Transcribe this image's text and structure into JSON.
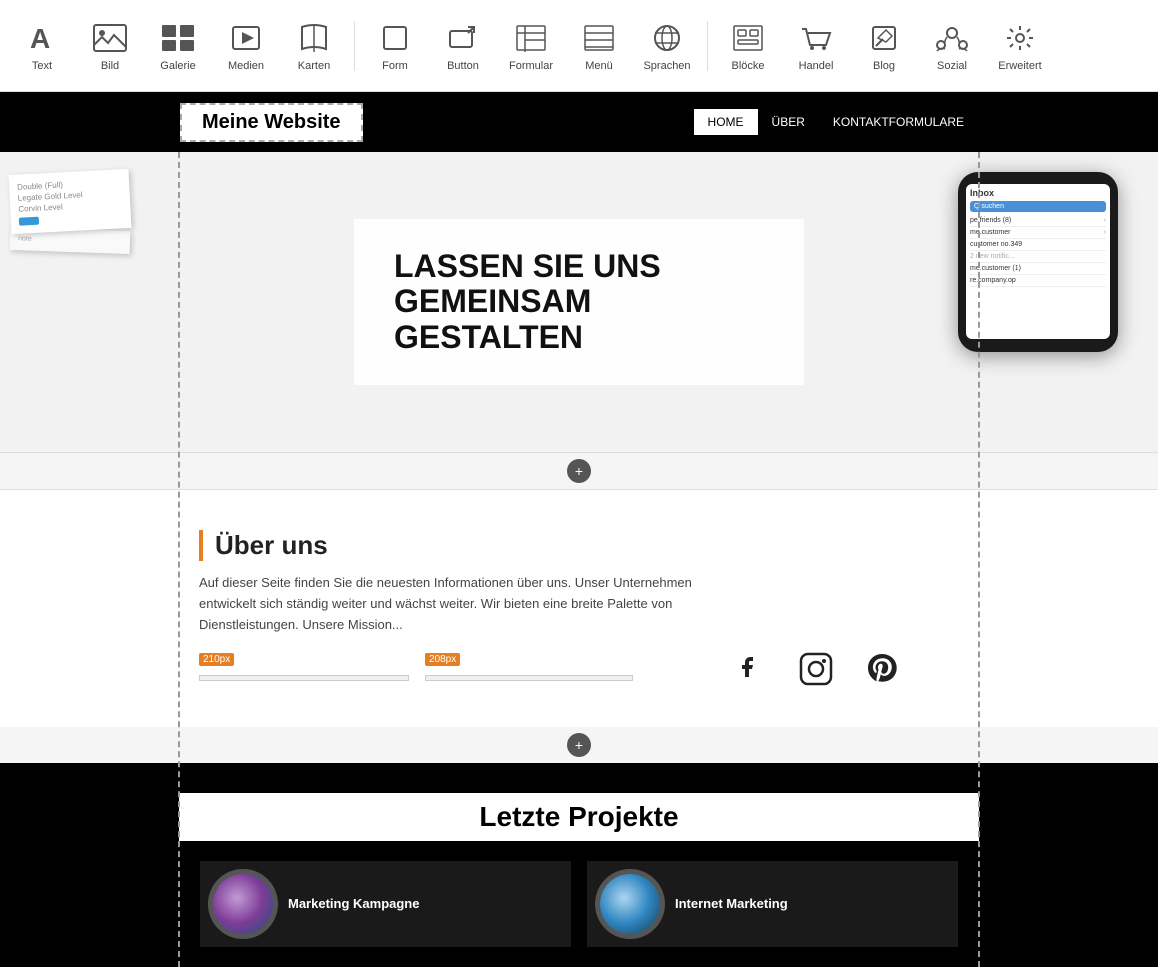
{
  "toolbar": {
    "items": [
      {
        "id": "text",
        "label": "Text",
        "icon": "A"
      },
      {
        "id": "bild",
        "label": "Bild",
        "icon": "🖼"
      },
      {
        "id": "galerie",
        "label": "Galerie",
        "icon": "⊞"
      },
      {
        "id": "medien",
        "label": "Medien",
        "icon": "▶"
      },
      {
        "id": "karten",
        "label": "Karten",
        "icon": "📖"
      },
      {
        "id": "form",
        "label": "Form",
        "icon": "□"
      },
      {
        "id": "button",
        "label": "Button",
        "icon": "↗"
      },
      {
        "id": "formular",
        "label": "Formular",
        "icon": "▦"
      },
      {
        "id": "menue",
        "label": "Menü",
        "icon": "⊟"
      },
      {
        "id": "sprachen",
        "label": "Sprachen",
        "icon": "🌐"
      },
      {
        "id": "bloecke",
        "label": "Blöcke",
        "icon": "⊡"
      },
      {
        "id": "handel",
        "label": "Handel",
        "icon": "🛒"
      },
      {
        "id": "blog",
        "label": "Blog",
        "icon": "✏"
      },
      {
        "id": "sozial",
        "label": "Sozial",
        "icon": "👥"
      },
      {
        "id": "erweitert",
        "label": "Erweitert",
        "icon": "⚙"
      }
    ]
  },
  "site": {
    "logo": "Meine Website",
    "nav": [
      {
        "label": "HOME",
        "active": true
      },
      {
        "label": "ÜBER",
        "active": false
      },
      {
        "label": "KONTAKTFORMULARE",
        "active": false
      }
    ]
  },
  "hero": {
    "title": "LASSEN SIE UNS GEMEINSAM GESTALTEN",
    "phone_inbox": "Inbox",
    "phone_search": "Q suchen",
    "phone_rows": [
      "pe.friends (8)",
      "me.customer",
      "customer no.349",
      "2 new notific...",
      "me.customer (1)",
      "re.company.op"
    ]
  },
  "about": {
    "heading": "Über uns",
    "text": "Auf dieser Seite finden Sie die neuesten Informationen über uns. Unser Unternehmen entwickelt sich ständig weiter und wächst weiter. Wir bieten eine breite Palette von Dienstleistungen. Unsere Mission...",
    "placeholder_210": "210px",
    "placeholder_208": "208px",
    "social_icons": [
      "f",
      "instagram",
      "p"
    ]
  },
  "projects": {
    "title": "Letzte Projekte",
    "cards": [
      {
        "name": "Marketing Kampagne"
      },
      {
        "name": "Internet Marketing"
      }
    ]
  },
  "colors": {
    "accent_orange": "#e67e22",
    "toolbar_bg": "#ffffff",
    "nav_bg": "#000000",
    "hero_bg": "#f2f2f2"
  }
}
